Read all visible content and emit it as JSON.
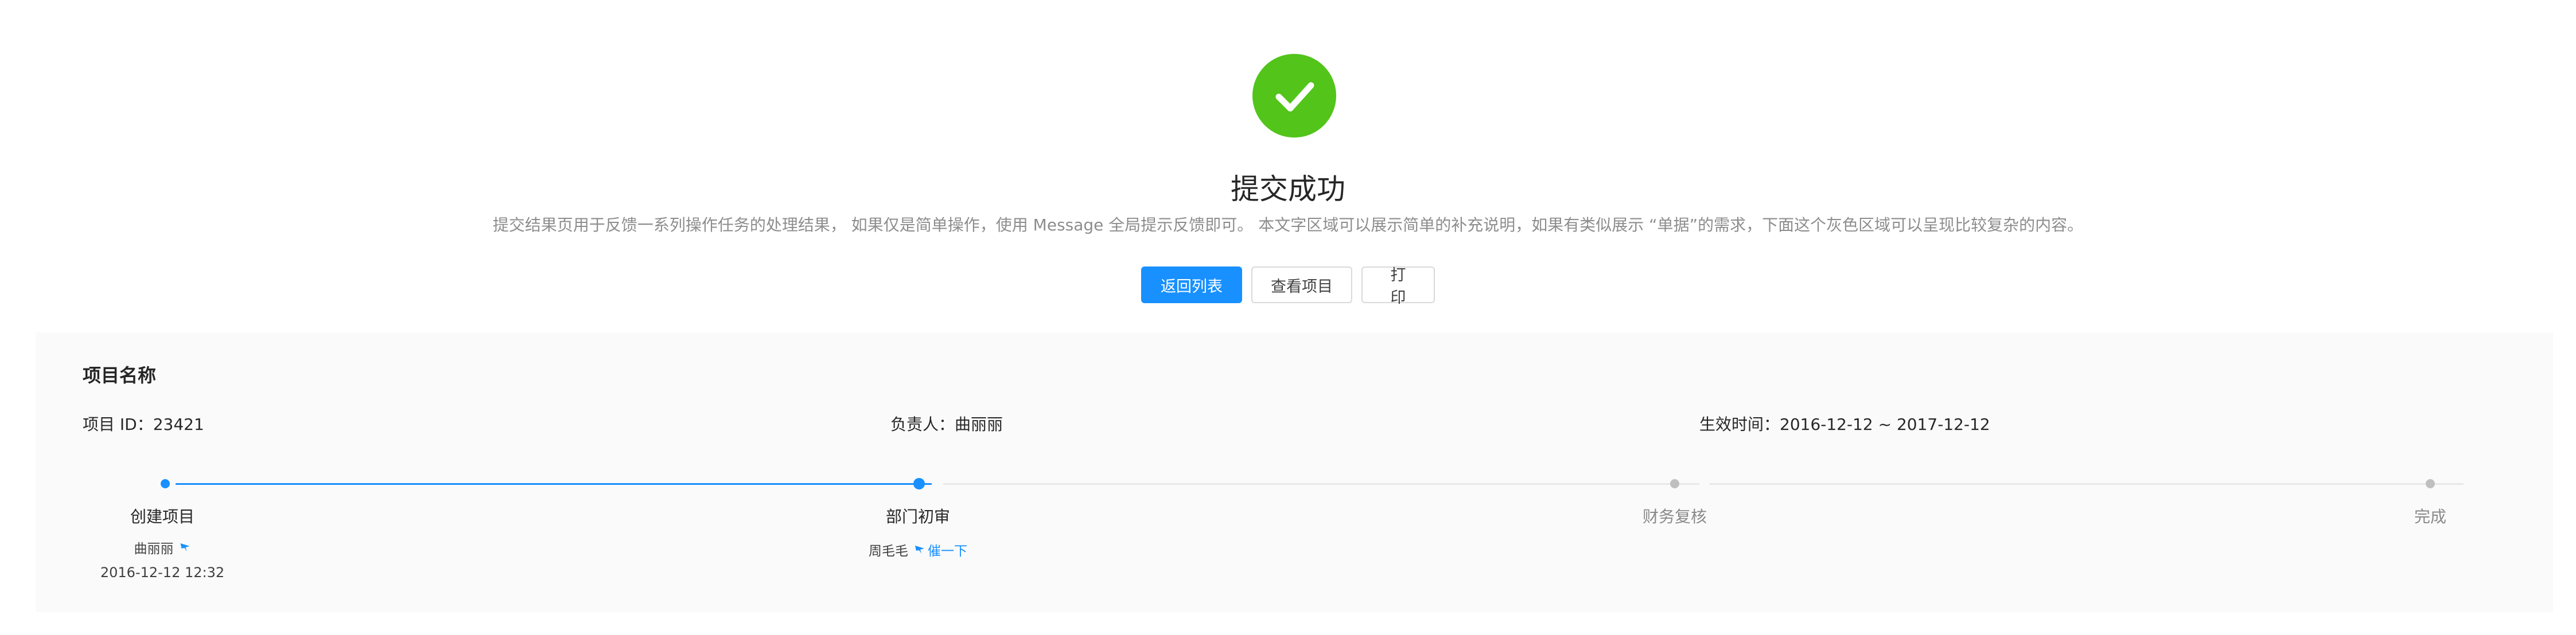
{
  "result": {
    "status": "success",
    "icon": "check-circle-icon",
    "icon_color": "#52c41a",
    "title": "提交成功",
    "description": "提交结果页用于反馈一系列操作任务的处理结果， 如果仅是简单操作，使用 Message 全局提示反馈即可。 本文字区域可以展示简单的补充说明，如果有类似展示 “单据”的需求，下面这个灰色区域可以呈现比较复杂的内容。"
  },
  "actions": {
    "back_label": "返回列表",
    "view_label": "查看项目",
    "print_label": "打 印"
  },
  "project": {
    "title": "项目名称",
    "id_text": "项目 ID：23421",
    "owner_text": "负责人：曲丽丽",
    "time_text": "生效时间：2016-12-12 ~ 2017-12-12"
  },
  "steps": [
    {
      "title": "创建项目",
      "status": "finish",
      "person": "曲丽丽",
      "icon": "dingding-icon",
      "date": "2016-12-12 12:32"
    },
    {
      "title": "部门初审",
      "status": "process",
      "person": "周毛毛",
      "icon": "dingding-icon",
      "link": "催一下"
    },
    {
      "title": "财务复核",
      "status": "wait"
    },
    {
      "title": "完成",
      "status": "wait"
    }
  ],
  "colors": {
    "primary": "#1890ff",
    "success": "#52c41a",
    "panel_bg": "#fafafa",
    "wait": "#bfbfbf"
  }
}
